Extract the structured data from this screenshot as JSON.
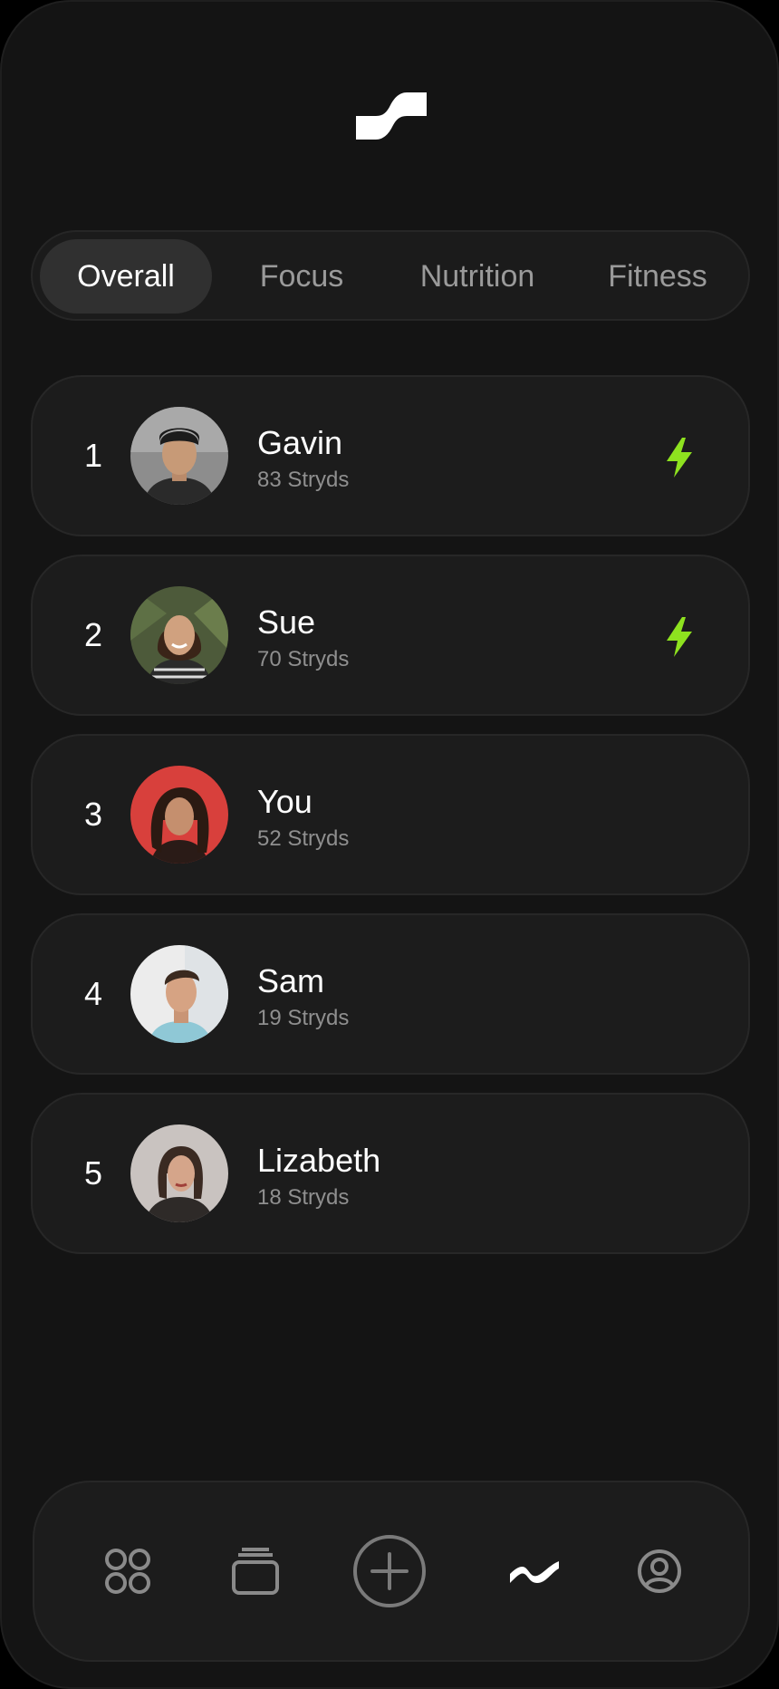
{
  "tabs": [
    {
      "label": "Overall",
      "active": true
    },
    {
      "label": "Focus",
      "active": false
    },
    {
      "label": "Nutrition",
      "active": false
    },
    {
      "label": "Fitness",
      "active": false
    }
  ],
  "leaderboard": [
    {
      "rank": "1",
      "name": "Gavin",
      "score": "83 Stryds",
      "streak": true
    },
    {
      "rank": "2",
      "name": "Sue",
      "score": "70 Stryds",
      "streak": true
    },
    {
      "rank": "3",
      "name": "You",
      "score": "52 Stryds",
      "streak": false
    },
    {
      "rank": "4",
      "name": "Sam",
      "score": "19 Stryds",
      "streak": false
    },
    {
      "rank": "5",
      "name": "Lizabeth",
      "score": "18 Stryds",
      "streak": false
    }
  ],
  "nav": [
    {
      "icon": "grid-icon",
      "active": false
    },
    {
      "icon": "stack-icon",
      "active": false
    },
    {
      "icon": "plus-circle-icon",
      "active": false
    },
    {
      "icon": "stryd-wave-icon",
      "active": true
    },
    {
      "icon": "profile-icon",
      "active": false
    }
  ],
  "colors": {
    "background": "#141414",
    "card": "#1c1c1c",
    "accent_bolt": "#8ee21f",
    "text_primary": "#ffffff",
    "text_secondary": "#8f8f8f"
  }
}
